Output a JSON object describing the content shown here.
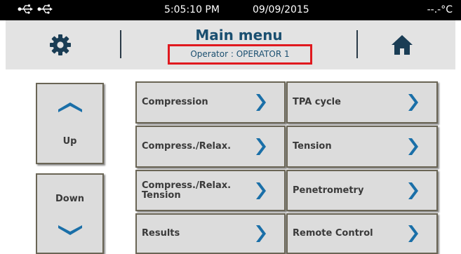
{
  "status_bar": {
    "time": "5:05:10 PM",
    "date": "09/09/2015",
    "temperature": "--.-°C",
    "icons": [
      "usb-icon",
      "usb-icon"
    ]
  },
  "header": {
    "title": "Main menu",
    "operator": "Operator : OPERATOR 1",
    "left_icon": "gear-icon",
    "right_icon": "home-icon",
    "highlight_color": "#e0191f"
  },
  "nav": {
    "up_label": "Up",
    "down_label": "Down"
  },
  "menu": {
    "items": [
      {
        "label": "Compression"
      },
      {
        "label": "TPA cycle"
      },
      {
        "label": "Compress./Relax."
      },
      {
        "label": "Tension"
      },
      {
        "label": "Compress./Relax.\nTension"
      },
      {
        "label": "Penetrometry"
      },
      {
        "label": "Results"
      },
      {
        "label": "Remote Control"
      }
    ]
  },
  "colors": {
    "accent": "#1a5d8e",
    "title": "#1a4f70",
    "button_bg": "#dcdcdc",
    "header_bg": "#e3e3e3"
  }
}
